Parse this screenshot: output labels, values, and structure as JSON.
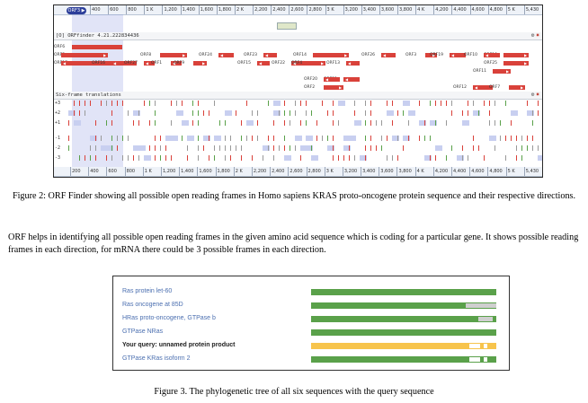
{
  "figure2": {
    "orf_finder_track_title": "[O] ORFfinder 4.21.222834436",
    "six_frame_title": "Six-frame translations",
    "selection_tag": "ORF3 ▶",
    "ruler_top": [
      "400",
      "600",
      "800",
      "1 K",
      "1,200",
      "1,400",
      "1,600",
      "1,800",
      "2 K",
      "2,200",
      "2,400",
      "2,600",
      "2,800",
      "3 K",
      "3,200",
      "3,400",
      "3,600",
      "3,800",
      "4 K",
      "4,200",
      "4,400",
      "4,600",
      "4,800",
      "5 K",
      "5,430"
    ],
    "ruler_bottom": [
      "200",
      "400",
      "600",
      "800",
      "1 K",
      "1,200",
      "1,400",
      "1,600",
      "1,800",
      "2 K",
      "2,200",
      "2,400",
      "2,600",
      "2,800",
      "3 K",
      "3,200",
      "3,400",
      "3,600",
      "3,800",
      "4 K",
      "4,200",
      "4,400",
      "4,600",
      "4,800",
      "5 K",
      "5,430"
    ],
    "orf_labels": [
      "ORF5",
      "ORF17",
      "ORF16",
      "ORF27",
      "ORF1",
      "ORF9",
      "ORF8",
      "ORF24",
      "ORF23",
      "ORF15",
      "ORF22",
      "ORF4",
      "ORF13",
      "ORF14",
      "ORF26",
      "ORF2",
      "ORF21",
      "ORF20",
      "ORF3",
      "ORF19",
      "ORF18",
      "ORF25",
      "ORF10",
      "ORF11",
      "ORF12",
      "ORF7",
      "ORF6"
    ],
    "frame_labels": [
      "+3",
      "+2",
      "+1",
      "-1",
      "-2",
      "-3"
    ],
    "caption": "Figure 2: ORF Finder showing all possible open reading frames in Homo sapiens KRAS proto-oncogene protein sequence and their respective directions."
  },
  "paragraph": "ORF helps in identifying all possible open reading frames in the given amino acid sequence which is coding for a particular gene. It shows possible reading frames in each direction, for mRNA there could be 3 possible frames in each direction.",
  "tree": {
    "rows": [
      {
        "label": "Ras protein let-60",
        "query": false
      },
      {
        "label": "Ras oncogene at 85D",
        "query": false
      },
      {
        "label": "HRas proto-oncogene, GTPase b",
        "query": false
      },
      {
        "label": "GTPase NRas",
        "query": false
      },
      {
        "label": "Your query: unnamed protein product",
        "query": true
      },
      {
        "label": "GTPase KRas isoform 2",
        "query": false
      }
    ],
    "caption": "Figure 3. The phylogenetic tree of all six sequences with the query sequence"
  },
  "colors": {
    "orf": "#d9413a",
    "tree_bar": "#5aa14a",
    "query_bar": "#f7c44c",
    "label_blue": "#4b6fb0"
  }
}
